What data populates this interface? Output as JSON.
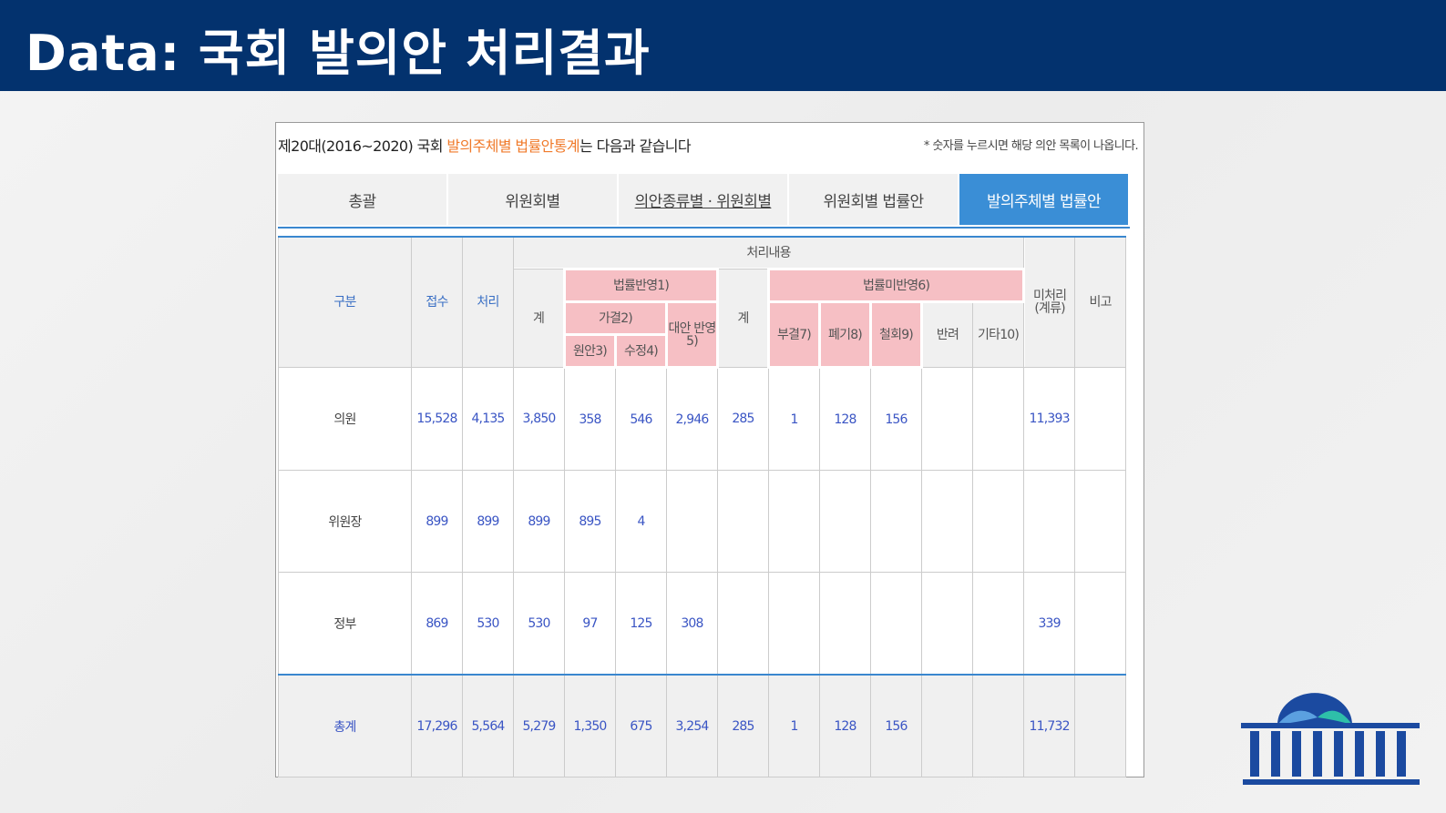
{
  "header": {
    "title": "Data: 국회 발의안 처리결과"
  },
  "intro": {
    "prefix": "제20대(2016~2020) 국회 ",
    "highlight": "발의주체별 법률안통계",
    "suffix": "는 다음과 같습니다",
    "note": "* 숫자를 누르시면 해당 의안 목록이 나옵니다."
  },
  "tabs": [
    {
      "label": "총괄"
    },
    {
      "label": "위원회별"
    },
    {
      "label": "의안종류별 · 위원회별"
    },
    {
      "label": "위원회별 법률안"
    },
    {
      "label": "발의주체별 법률안"
    }
  ],
  "columns": {
    "gubun": "구분",
    "jeopsu": "접수",
    "cheori": "처리",
    "cheori_naeyong": "처리내용",
    "banyoung": "법률반영1)",
    "gye1": "계",
    "gagyeol": "가결2)",
    "wonan": "원안3)",
    "sujeong": "수정4)",
    "daean": "대안 반영5)",
    "mibanyoung": "법률미반영6)",
    "gye2": "계",
    "bugyeol": "부결7)",
    "pyegi": "폐기8)",
    "cheolhoe": "철회9)",
    "banryeo": "반려",
    "gita": "기타10)",
    "micheori": "미처리 (계류)",
    "bigo": "비고"
  },
  "rows": [
    {
      "label": "의원",
      "jeopsu": "15,528",
      "cheori": "4,135",
      "gye1": "3,850",
      "wonan": "358",
      "sujeong": "546",
      "daean": "2,946",
      "gye2": "285",
      "bugyeol": "1",
      "pyegi": "128",
      "cheolhoe": "156",
      "banryeo": "",
      "gita": "",
      "micheori": "11,393",
      "bigo": ""
    },
    {
      "label": "위원장",
      "jeopsu": "899",
      "cheori": "899",
      "gye1": "899",
      "wonan": "895",
      "sujeong": "4",
      "daean": "",
      "gye2": "",
      "bugyeol": "",
      "pyegi": "",
      "cheolhoe": "",
      "banryeo": "",
      "gita": "",
      "micheori": "",
      "bigo": ""
    },
    {
      "label": "정부",
      "jeopsu": "869",
      "cheori": "530",
      "gye1": "530",
      "wonan": "97",
      "sujeong": "125",
      "daean": "308",
      "gye2": "",
      "bugyeol": "",
      "pyegi": "",
      "cheolhoe": "",
      "banryeo": "",
      "gita": "",
      "micheori": "339",
      "bigo": ""
    }
  ],
  "total": {
    "label": "총계",
    "jeopsu": "17,296",
    "cheori": "5,564",
    "gye1": "5,279",
    "wonan": "1,350",
    "sujeong": "675",
    "daean": "3,254",
    "gye2": "285",
    "bugyeol": "1",
    "pyegi": "128",
    "cheolhoe": "156",
    "banryeo": "",
    "gita": "",
    "micheori": "11,732",
    "bigo": ""
  },
  "colors": {
    "header": "#03326e",
    "accent": "#3a8ed6",
    "highlight": "#f07a2a",
    "pink": "#f6bfc4",
    "value": "#3a55c4"
  },
  "logo": {
    "icon": "national-assembly-logo-icon"
  }
}
